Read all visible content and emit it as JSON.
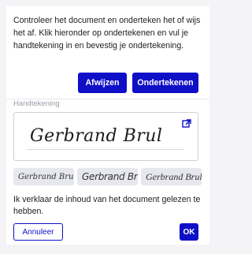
{
  "instructions": "Controleer het document en onderteken het of wijs het af. Klik hieronder op ondertekenen en vul je handtekening in en bevestig je ondertekening.",
  "actions": {
    "reject_label": "Afwijzen",
    "sign_label": "Ondertekenen"
  },
  "signature": {
    "label": "Handtekening",
    "value": "Gerbrand Brul",
    "open_icon": "external-link-icon",
    "style_options": [
      "Gerbrand Brul",
      "Gerbrand Brul",
      "Gerbrand Brul"
    ]
  },
  "confirmation": {
    "text": "Ik verklaar de inhoud van het document gelezen te hebben.",
    "cancel_label": "Annuleer",
    "ok_label": "OK"
  },
  "colors": {
    "primary": "#0f0fc8",
    "style_option_bg": "#e7e7f0",
    "label_gray": "#9a9aa8"
  }
}
